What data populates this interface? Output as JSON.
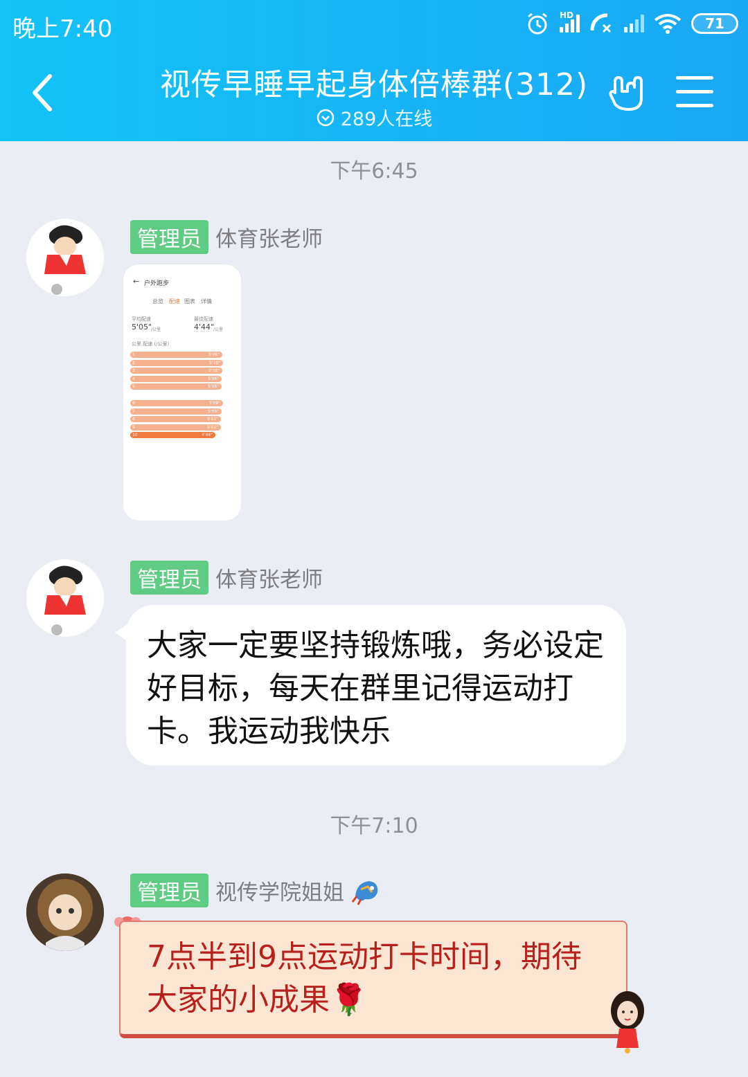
{
  "status_bar": {
    "time": "晚上7:40",
    "network": "HD",
    "battery": "71",
    "icons": [
      "alarm-icon",
      "signal-icon",
      "call-icon",
      "signal-icon",
      "wifi-icon",
      "battery-icon"
    ]
  },
  "header": {
    "title": "视传早睡早起身体倍棒群(312)",
    "online": "289人在线",
    "icons": [
      "back-icon",
      "hand-rock-icon",
      "menu-icon"
    ]
  },
  "colors": {
    "header_bg": "#12c3f7",
    "page_bg": "#ebedf4",
    "badge_bg": "#5fcb83",
    "deco_bubble_text": "#b8201b"
  },
  "messages": [
    {
      "time": "下午6:45",
      "badge": "管理员",
      "sender": "体育张老师",
      "type": "image",
      "image": {
        "title": "户外跑步",
        "tabs": [
          "总览",
          "配速",
          "图表",
          "详情"
        ],
        "avg_pace_label": "平均配速",
        "avg_pace": "5'05\"",
        "best_pace_label": "最佳配速",
        "best_pace": "4'44\"",
        "unit": "/公里",
        "table_header": "公里  配速 (/公里)",
        "rows": [
          {
            "km": "1",
            "pace": "5'08\""
          },
          {
            "km": "2",
            "pace": "5'10\""
          },
          {
            "km": "3",
            "pace": "5'08\""
          },
          {
            "km": "4",
            "pace": "5'06\""
          },
          {
            "km": "5",
            "pace": "5'06\""
          },
          {
            "km": "6",
            "pace": "5'09\""
          },
          {
            "km": "7",
            "pace": "5'05\""
          },
          {
            "km": "8",
            "pace": "5'03\""
          },
          {
            "km": "9",
            "pace": "5'02\""
          },
          {
            "km": "10",
            "pace": "4'44\""
          }
        ]
      }
    },
    {
      "badge": "管理员",
      "sender": "体育张老师",
      "type": "text",
      "text": "大家一定要坚持锻炼哦，务必设定好目标，每天在群里记得运动打卡。我运动我快乐"
    },
    {
      "time": "下午7:10",
      "badge": "管理员",
      "sender": "视传学院姐姐",
      "type": "text",
      "text": "7点半到9点运动打卡时间，期待大家的小成果",
      "emoji": "🌹"
    }
  ]
}
